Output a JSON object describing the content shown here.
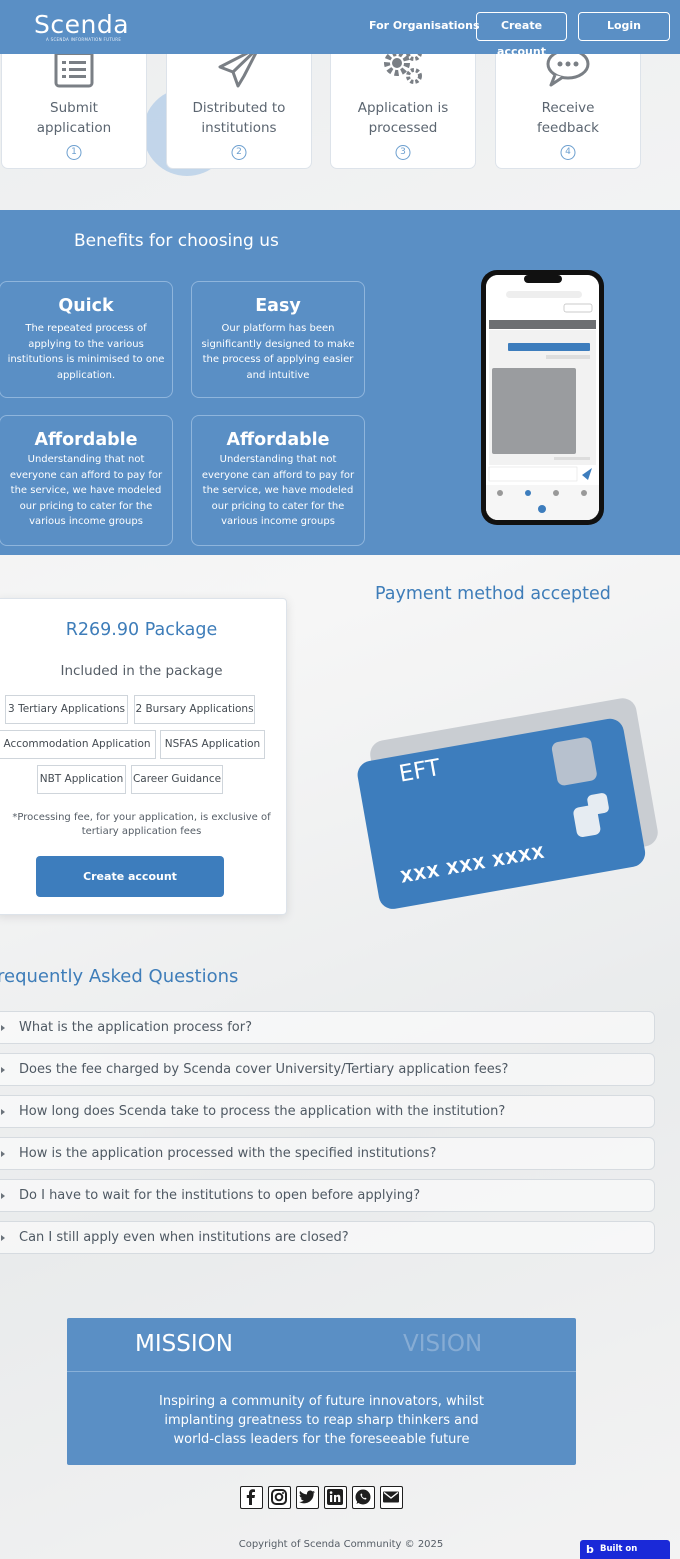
{
  "header": {
    "logo": "Scenda",
    "logo_tagline": "A SCENDA INFORMATION FUTURE",
    "nav_org": "For Organisations",
    "create_account": "Create account",
    "login": "Login"
  },
  "steps": [
    {
      "label": "Submit\napplication",
      "number": "1",
      "icon": "form-icon"
    },
    {
      "label": "Distributed to\ninstitutions",
      "number": "2",
      "icon": "paper-plane-icon"
    },
    {
      "label": "Application is\nprocessed",
      "number": "3",
      "icon": "gears-icon"
    },
    {
      "label": "Receive\nfeedback",
      "number": "4",
      "icon": "chat-bubble-icon"
    }
  ],
  "benefits": {
    "title": "Benefits for choosing us",
    "cards": [
      {
        "title": "Quick",
        "text": "The repeated process of\napplying to the various\ninstitutions is minimised to one\napplication."
      },
      {
        "title": "Easy",
        "text": "Our platform has been\nsignificantly designed to make\nthe process of applying easier\nand intuitive"
      },
      {
        "title": "Affordable",
        "text": "Understanding that not\neveryone can afford to pay for\nthe service, we have modeled\nour pricing to cater for the\nvarious income groups"
      },
      {
        "title": "Affordable",
        "text": "Understanding that not\neveryone can afford to pay for\nthe service, we have modeled\nour pricing to cater for the\nvarious income groups"
      }
    ]
  },
  "package": {
    "title": "R269.90 Package",
    "subtitle": "Included in the package",
    "items": [
      "3 Tertiary Applications",
      "2 Bursary Applications",
      "Accommodation Application",
      "NSFAS Application",
      "NBT Application",
      "Career Guidance"
    ],
    "note": "*Processing fee, for your application, is exclusive of\ntertiary application fees",
    "button": "Create account"
  },
  "payment": {
    "title": "Payment method accepted",
    "card_label": "EFT",
    "card_number": "XXX XXX XXXX"
  },
  "faq": {
    "title": "requently Asked Questions",
    "questions": [
      "What is the application process for?",
      "Does the fee charged by Scenda cover University/Tertiary application fees?",
      "How long does Scenda take to process the application with the institution?",
      "How is the application processed with the specified institutions?",
      "Do I have to wait for the institutions to open before applying?",
      "Can I still apply even when institutions are closed?"
    ]
  },
  "mission": {
    "tab_mission": "MISSION",
    "tab_vision": "VISION",
    "text": "Inspiring a community of future innovators, whilst\nimplanting greatness to reap sharp thinkers and\nworld-class leaders for the foreseeable future"
  },
  "footer": {
    "socials": [
      "facebook-icon",
      "instagram-icon",
      "twitter-icon",
      "linkedin-icon",
      "whatsapp-icon",
      "email-icon"
    ],
    "copyright": "Copyright of Scenda Community © 2025",
    "bubble": "Built on Bubble"
  },
  "colors": {
    "brand_blue": "#5a8fc5",
    "accent_blue": "#3d7dbd",
    "bubble_blue": "#1a29d8"
  }
}
